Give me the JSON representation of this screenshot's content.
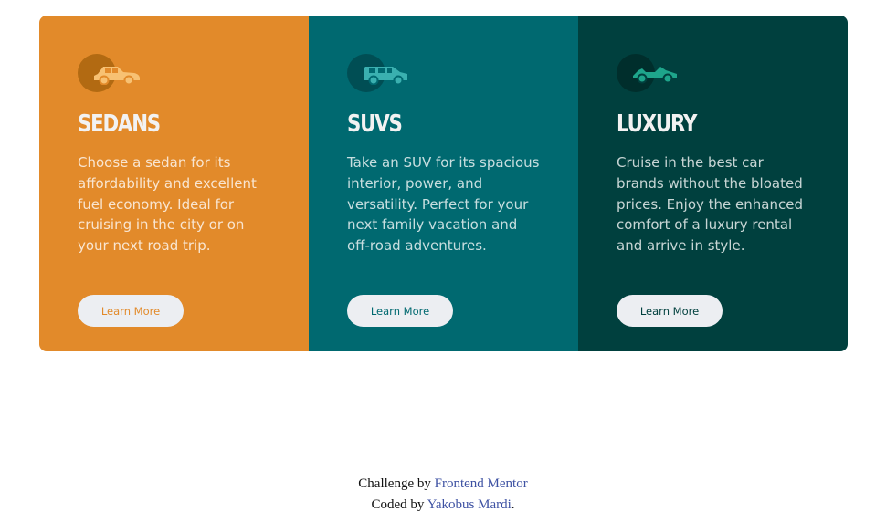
{
  "cards": [
    {
      "icon": "sedan-car-icon",
      "title": "SEDANS",
      "text": "Choose a sedan for its affordability and excellent fuel economy. Ideal for cruising in the city or on your next road trip.",
      "button_label": "Learn More",
      "color": "#e28a2a"
    },
    {
      "icon": "suv-car-icon",
      "title": "SUVS",
      "text": "Take an SUV for its spacious interior, power, and versatility. Perfect for your next family vacation and off-road adventures.",
      "button_label": "Learn More",
      "color": "#006970"
    },
    {
      "icon": "luxury-car-icon",
      "title": "LUXURY",
      "text": "Cruise in the best car brands without the bloated prices. Enjoy the enhanced comfort of a luxury rental and arrive in style.",
      "button_label": "Learn More",
      "color": "#00403e"
    }
  ],
  "attribution": {
    "line1_prefix": "Challenge by ",
    "line1_link": "Frontend Mentor",
    "line2_prefix": "Coded by ",
    "line2_link": "Yakobus Mardi",
    "line2_suffix": "."
  },
  "colors": {
    "icon_sedan": "#f7c173",
    "icon_suv": "#3ab0b0",
    "icon_luxury": "#1ea58b",
    "button_bg": "#eceef2",
    "link": "#3e52a3"
  }
}
